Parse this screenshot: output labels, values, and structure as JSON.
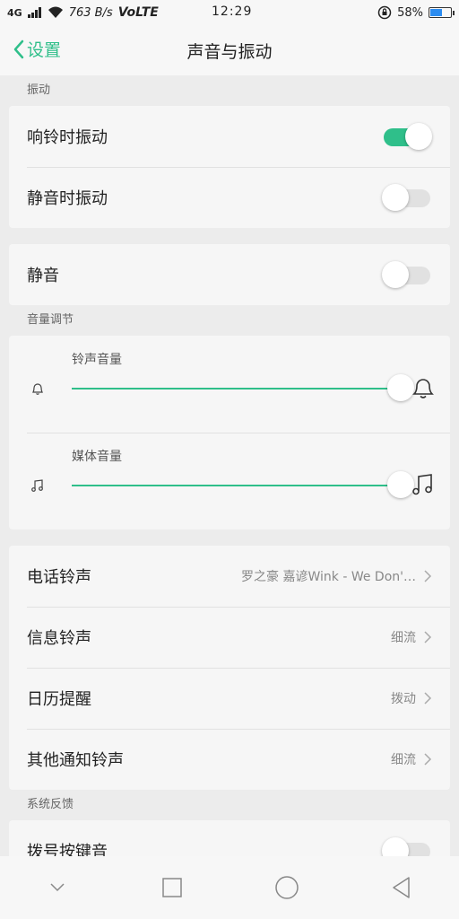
{
  "status": {
    "signal": "4G",
    "net_speed": "763 B/s",
    "volte": "VoLTE",
    "time": "12:29",
    "battery": "58%",
    "battery_level": 0.58
  },
  "nav": {
    "back_label": "设置",
    "title": "声音与振动"
  },
  "vibration": {
    "section_label": "振动",
    "ring_vibrate": {
      "label": "响铃时振动",
      "on": true
    },
    "silent_vibrate": {
      "label": "静音时振动",
      "on": false
    }
  },
  "silent": {
    "label": "静音",
    "on": false
  },
  "volume": {
    "section_label": "音量调节",
    "ringtone": {
      "label": "铃声音量",
      "level": 1.0
    },
    "media": {
      "label": "媒体音量",
      "level": 1.0
    }
  },
  "ringtones": [
    {
      "label": "电话铃声",
      "value": "罗之豪 嘉谚Wink - We Don'…"
    },
    {
      "label": "信息铃声",
      "value": "细流"
    },
    {
      "label": "日历提醒",
      "value": "拨动"
    },
    {
      "label": "其他通知铃声",
      "value": "细流"
    }
  ],
  "feedback": {
    "section_label": "系统反馈",
    "partial_row_label": "拨号按键音"
  },
  "colors": {
    "accent": "#2fbf8a",
    "background": "#ececec",
    "card": "#f6f6f6"
  }
}
